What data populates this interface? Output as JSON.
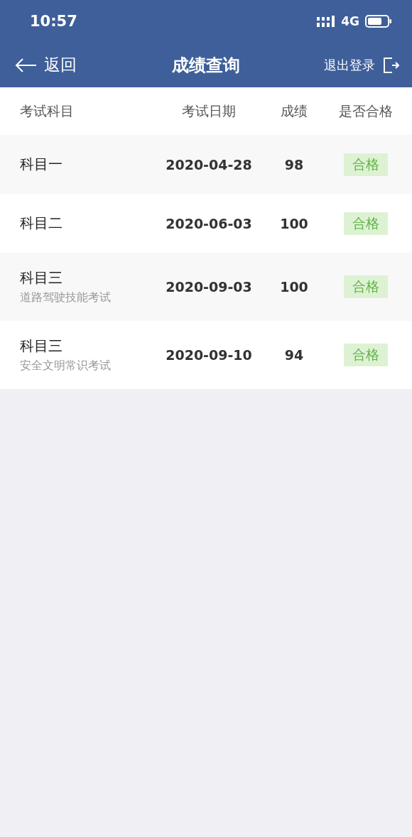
{
  "status_bar": {
    "time": "10:57",
    "network": "4G"
  },
  "nav_bar": {
    "back_label": "返回",
    "title": "成绩查询",
    "logout_label": "退出登录"
  },
  "table": {
    "columns": [
      "考试科目",
      "考试日期",
      "成绩",
      "是否合格"
    ],
    "rows": [
      {
        "subject": "科目一",
        "date": "2020-04-28",
        "score": "98",
        "result": "合格",
        "passed": true
      },
      {
        "subject": "科目二",
        "date": "2020-06-03",
        "score": "100",
        "result": "合格",
        "passed": true
      },
      {
        "subject": "科目三",
        "subtitle": "道路驾驶技能考试",
        "date": "2020-09-03",
        "score": "100",
        "result": "合格",
        "passed": true
      },
      {
        "subject": "科目三",
        "subtitle": "安全文明常识考试",
        "date": "2020-09-10",
        "score": "94",
        "result": "合格",
        "passed": true
      }
    ]
  }
}
